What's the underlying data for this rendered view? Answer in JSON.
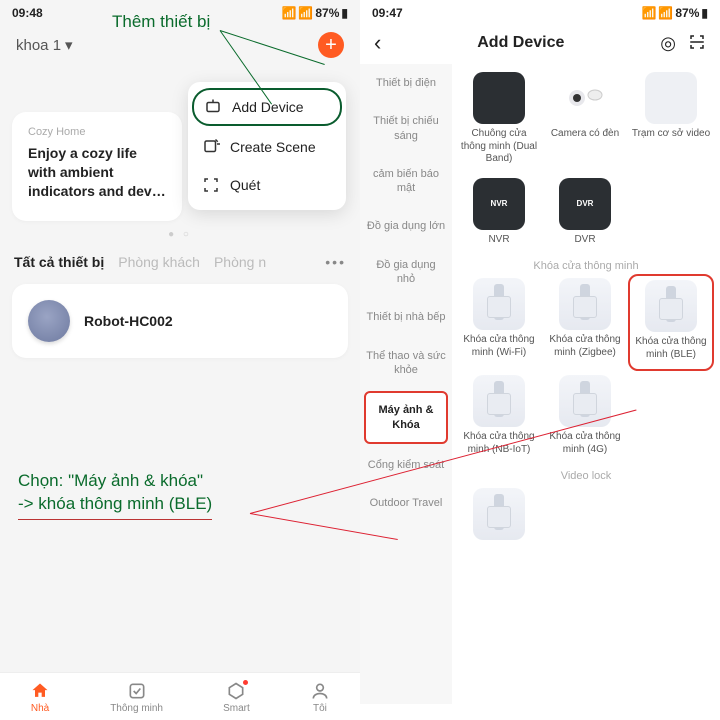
{
  "annotations": {
    "top": "Thêm thiết bị",
    "mid_line1": "Chọn: \"Máy ảnh & khóa\"",
    "mid_line2": "-> khóa thông minh (BLE)"
  },
  "left": {
    "status": {
      "time": "09:48",
      "battery": "87%"
    },
    "home_label": "khoa 1",
    "card": {
      "sub": "Cozy Home",
      "title": "Enjoy a cozy life with ambient indicators and dev…"
    },
    "popup": {
      "add": "Add Device",
      "scene": "Create Scene",
      "scan": "Quét"
    },
    "tabs": {
      "all": "Tất cả thiết bị",
      "room1": "Phòng khách",
      "room2": "Phòng n"
    },
    "device": "Robot-HC002",
    "nav": {
      "home": "Nhà",
      "smart1": "Thông minh",
      "smart2": "Smart",
      "me": "Tôi"
    }
  },
  "right": {
    "status": {
      "time": "09:47",
      "battery": "87%"
    },
    "title": "Add Device",
    "categories": [
      "Thiết bị điện",
      "Thiết bị chiếu sáng",
      "cảm biến báo mật",
      "Đồ gia dụng lớn",
      "Đồ gia dụng nhỏ",
      "Thiết bị nhà bếp",
      "Thể thao và sức khỏe",
      "Máy ảnh & Khóa",
      "Cổng kiểm soát",
      "Outdoor Travel"
    ],
    "section_lock": "Khóa cửa thông minh",
    "section_video": "Video lock",
    "items_top": [
      "Chuông cửa thông minh (Dual Band)",
      "Camera có đèn",
      "Trạm cơ sở video"
    ],
    "items_rec": [
      "NVR",
      "DVR"
    ],
    "locks": [
      "Khóa cửa thông minh (Wi-Fi)",
      "Khóa cửa thông minh (Zigbee)",
      "Khóa cửa thông minh (BLE)",
      "Khóa cửa thông minh (NB-IoT)",
      "Khóa cửa thông minh (4G)"
    ]
  }
}
